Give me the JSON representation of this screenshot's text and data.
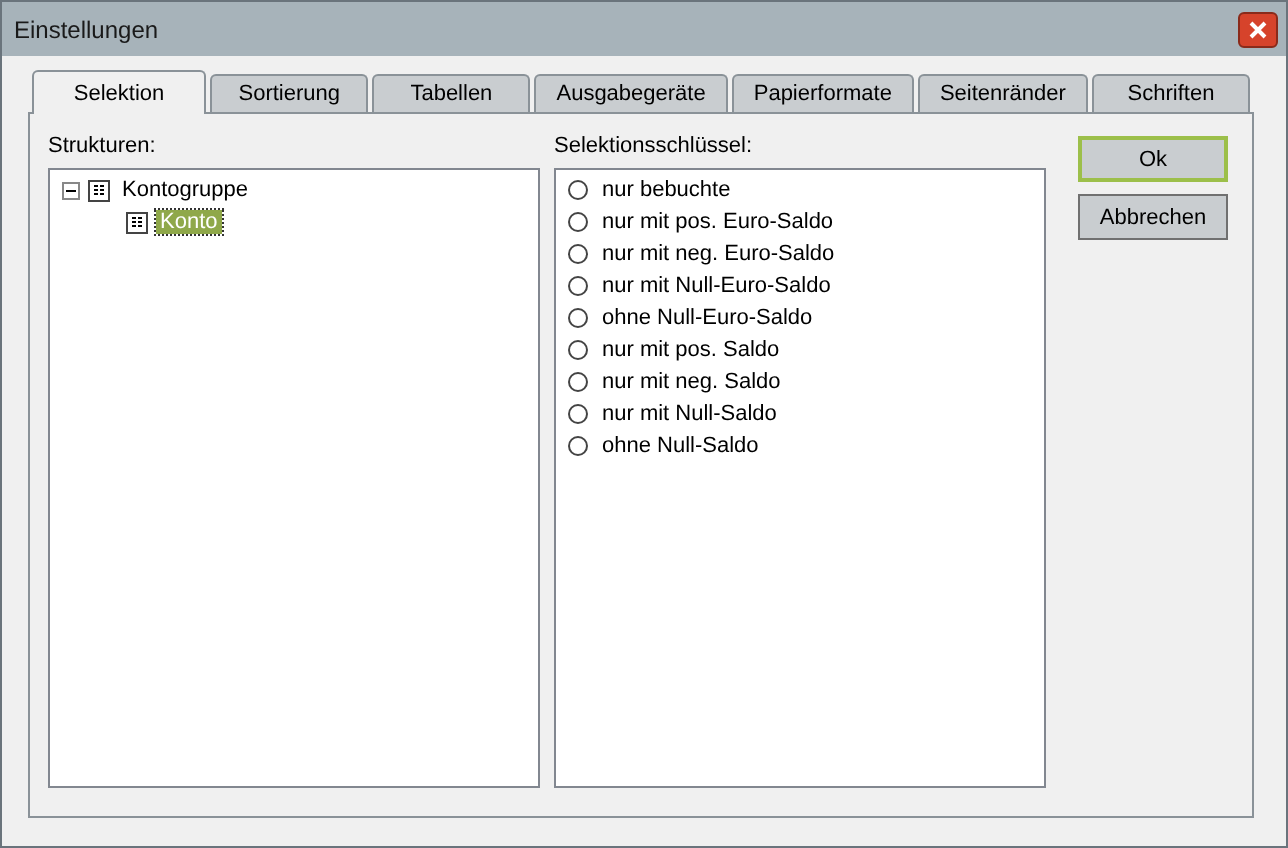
{
  "window": {
    "title": "Einstellungen"
  },
  "tabs": [
    {
      "label": "Selektion",
      "selected": true
    },
    {
      "label": "Sortierung",
      "selected": false
    },
    {
      "label": "Tabellen",
      "selected": false
    },
    {
      "label": "Ausgabegeräte",
      "selected": false
    },
    {
      "label": "Papierformate",
      "selected": false
    },
    {
      "label": "Seitenränder",
      "selected": false
    },
    {
      "label": "Schriften",
      "selected": false
    }
  ],
  "structures": {
    "label": "Strukturen:",
    "tree": [
      {
        "label": "Kontogruppe",
        "expanded": true,
        "selected": false,
        "children": [
          {
            "label": "Konto",
            "selected": true
          }
        ]
      }
    ]
  },
  "keys": {
    "label": "Selektionsschlüssel:",
    "options": [
      {
        "label": "nur bebuchte",
        "selected": false
      },
      {
        "label": "nur mit pos. Euro-Saldo",
        "selected": false
      },
      {
        "label": "nur mit neg. Euro-Saldo",
        "selected": false
      },
      {
        "label": "nur mit Null-Euro-Saldo",
        "selected": false
      },
      {
        "label": "ohne Null-Euro-Saldo",
        "selected": false
      },
      {
        "label": "nur mit pos. Saldo",
        "selected": false
      },
      {
        "label": "nur mit neg. Saldo",
        "selected": false
      },
      {
        "label": "nur mit Null-Saldo",
        "selected": false
      },
      {
        "label": "ohne Null-Saldo",
        "selected": false
      }
    ]
  },
  "buttons": [
    {
      "label": "Ok",
      "default": true
    },
    {
      "label": "Abbrechen",
      "default": false
    }
  ]
}
